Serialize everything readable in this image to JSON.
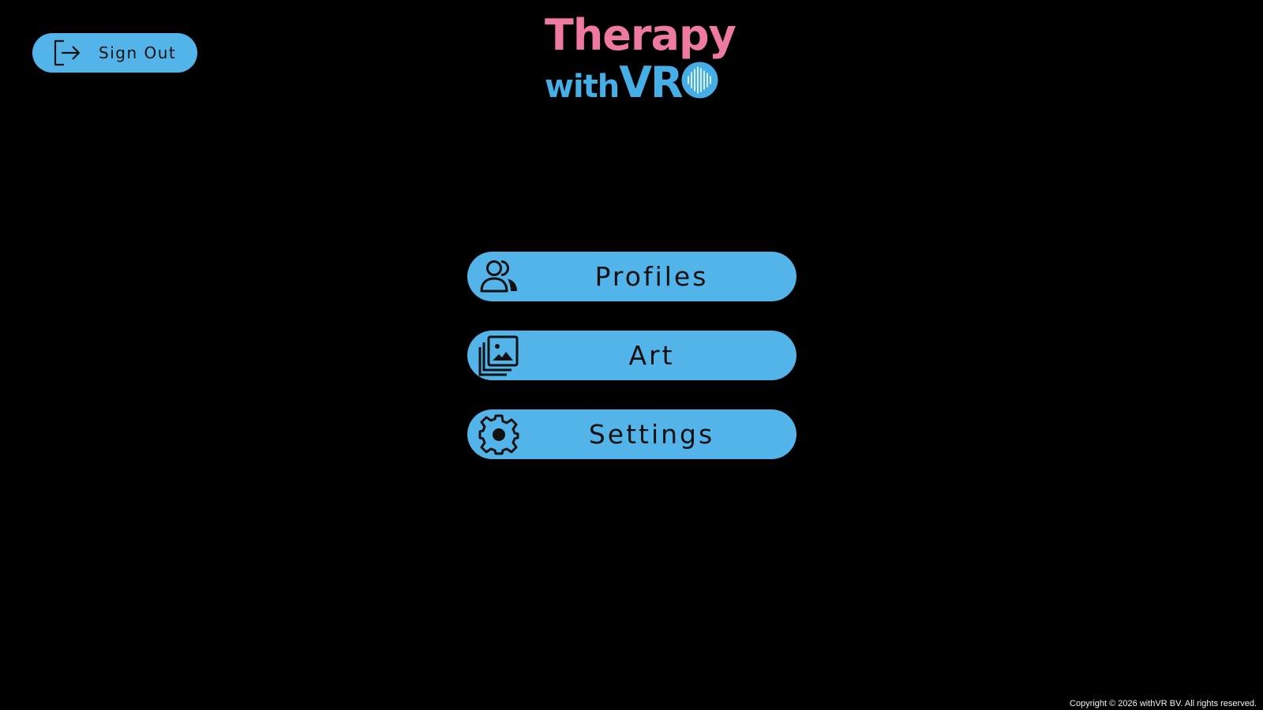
{
  "header": {
    "sign_out_label": "Sign Out",
    "sign_out_icon": "sign-out-icon",
    "logo": {
      "line1": "Therapy",
      "line2_with": "with",
      "line2_vr": "VR",
      "badge_icon": "sound-wave-badge-icon"
    }
  },
  "menu": {
    "items": [
      {
        "label": "Profiles",
        "icon": "users-icon"
      },
      {
        "label": "Art",
        "icon": "image-gallery-icon"
      },
      {
        "label": "Settings",
        "icon": "gear-icon"
      }
    ]
  },
  "footer": {
    "copyright": "Copyright © 2026 withVR BV. All rights reserved."
  },
  "colors": {
    "background": "#000000",
    "button": "#52b4e8",
    "logo_pink": "#ef7aa0",
    "logo_blue": "#46aee6"
  }
}
